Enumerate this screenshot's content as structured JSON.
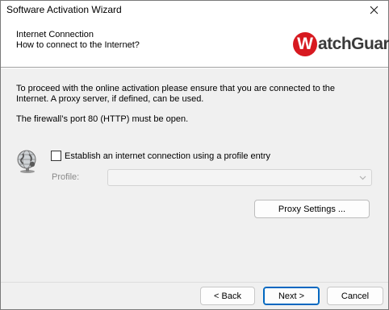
{
  "window": {
    "title": "Software Activation Wizard"
  },
  "header": {
    "title": "Internet Connection",
    "subtitle": "How to connect to the Internet?",
    "logo_letter": "W",
    "logo_text": "atchGuard",
    "logo_tm": "®",
    "logo_color": "#d71920"
  },
  "content": {
    "paragraph1": "To proceed with the online activation please ensure that you are connected to the Internet. A proxy server, if defined, can be used.",
    "paragraph2": "The firewall’s port 80 (HTTP) must be open.",
    "checkbox_label": "Establish an internet connection using a profile entry",
    "checkbox_checked": false,
    "profile_label": "Profile:",
    "profile_value": "",
    "proxy_button": "Proxy Settings ..."
  },
  "footer": {
    "back": "< Back",
    "next": "Next >",
    "cancel": "Cancel",
    "accent_color": "#0067c0"
  },
  "icons": {
    "close": "close-icon",
    "globe": "globe-network-icon",
    "chevron": "chevron-down-icon"
  }
}
